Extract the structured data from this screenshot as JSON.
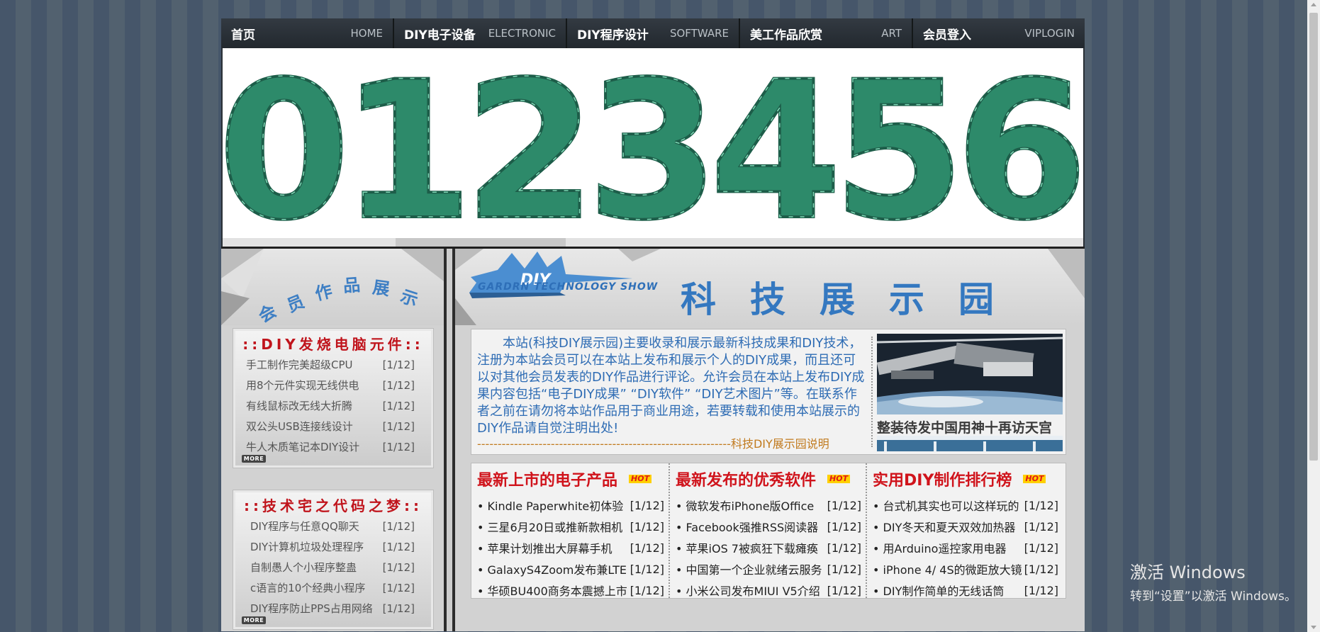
{
  "nav": [
    {
      "cn": "首页",
      "en": "HOME"
    },
    {
      "cn": "DIY电子设备",
      "en": "ELECTRONIC"
    },
    {
      "cn": "DIY程序设计",
      "en": "SOFTWARE"
    },
    {
      "cn": "美工作品欣赏",
      "en": "ART"
    },
    {
      "cn": "会员登入",
      "en": "VIPLOGIN"
    }
  ],
  "banner": {
    "digits": [
      "0",
      "1",
      "2",
      "3",
      "4",
      "5",
      "6"
    ],
    "colors": {
      "board": "#2d8a6a",
      "trace": "#7fd8b6",
      "edge": "#1d5d49"
    }
  },
  "left": {
    "heading_chars": [
      "会",
      "员",
      "作",
      "品",
      "展",
      "示"
    ],
    "panels": [
      {
        "title": "::DIY发烧电脑元件::",
        "more": "MORE",
        "items": [
          {
            "text": "手工制作完美超级CPU",
            "count": "[1/12]"
          },
          {
            "text": "用8个元件实现无线供电",
            "count": "[1/12]"
          },
          {
            "text": "有线鼠标改无线大折腾",
            "count": "[1/12]"
          },
          {
            "text": "双公头USB连接线设计",
            "count": "[1/12]"
          },
          {
            "text": "牛人木质笔记本DIY设计",
            "count": "[1/12]"
          }
        ]
      },
      {
        "title": "::技术宅之代码之梦::",
        "more": "MORE",
        "items": [
          {
            "text": "DIY程序与任意QQ聊天",
            "count": "[1/12]"
          },
          {
            "text": "DIY计算机垃圾处理程序",
            "count": "[1/12]"
          },
          {
            "text": "自制愚人个小程序整蛊",
            "count": "[1/12]"
          },
          {
            "text": "c语言的10个经典小程序",
            "count": "[1/12]"
          },
          {
            "text": "DIY程序防止PPS占用网络",
            "count": "[1/12]"
          }
        ]
      }
    ]
  },
  "right": {
    "logo": {
      "diy": "DIY",
      "caption": "GARDRN  TECHNOLOGY SHOW"
    },
    "title_chars": [
      "科",
      "技",
      "展",
      "示",
      "园"
    ],
    "intro": {
      "text": "本站(科技DIY展示园)主要收录和展示最新科技成果和DIY技术，注册为本站会员可以在本站上发布和展示个人的DIY成果，而且还可以对其他会员发表的DIY作品进行评论。允许会员在本站上发布DIY成果内容包括“电子DIY成果” “DIY软件” “DIY艺术图片”等。在联系作者之前在请勿将本站作品用于商业用途，若要转载和使用本站展示的DIY作品请自觉注明出处!",
      "signature": "--------------------------------------------------------------科技DIY展示园说明"
    },
    "photo_caption": "整装待发中国用神十再访天宫",
    "news": [
      {
        "title": "最新上市的电子产品",
        "badge": "HOT",
        "items": [
          {
            "text": "• Kindle Paperwhite初体验",
            "count": "[1/12]"
          },
          {
            "text": "• 三星6月20日或推新款相机",
            "count": "[1/12]"
          },
          {
            "text": "• 苹果计划推出大屏幕手机",
            "count": "[1/12]"
          },
          {
            "text": "• GalaxyS4Zoom发布兼LTE",
            "count": "[1/12]"
          },
          {
            "text": "• 华硕BU400商务本震撼上市",
            "count": "[1/12]"
          }
        ]
      },
      {
        "title": "最新发布的优秀软件",
        "badge": "HOT",
        "items": [
          {
            "text": "• 微软发布iPhone版Office",
            "count": "[1/12]"
          },
          {
            "text": "• Facebook强推RSS阅读器",
            "count": "[1/12]"
          },
          {
            "text": "• 苹果iOS 7被疯狂下载瘫痪",
            "count": "[1/12]"
          },
          {
            "text": "• 中国第一个企业就绪云服务",
            "count": "[1/12]"
          },
          {
            "text": "• 小米公司发布MIUI V5介绍",
            "count": "[1/12]"
          }
        ]
      },
      {
        "title": "实用DIY制作排行榜",
        "badge": "HOT",
        "items": [
          {
            "text": "• 台式机其实也可以这样玩的",
            "count": "[1/12]"
          },
          {
            "text": "• DIY冬天和夏天双效加热器",
            "count": "[1/12]"
          },
          {
            "text": "• 用Arduino遥控家用电器",
            "count": "[1/12]"
          },
          {
            "text": "• iPhone 4/ 4S的微距放大镜",
            "count": "[1/12]"
          },
          {
            "text": "• DIY制作简单的无线话筒",
            "count": "[1/12]"
          }
        ]
      }
    ]
  },
  "watermark": {
    "line1": "激活 Windows",
    "line2": "转到“设置”以激活 Windows。"
  }
}
